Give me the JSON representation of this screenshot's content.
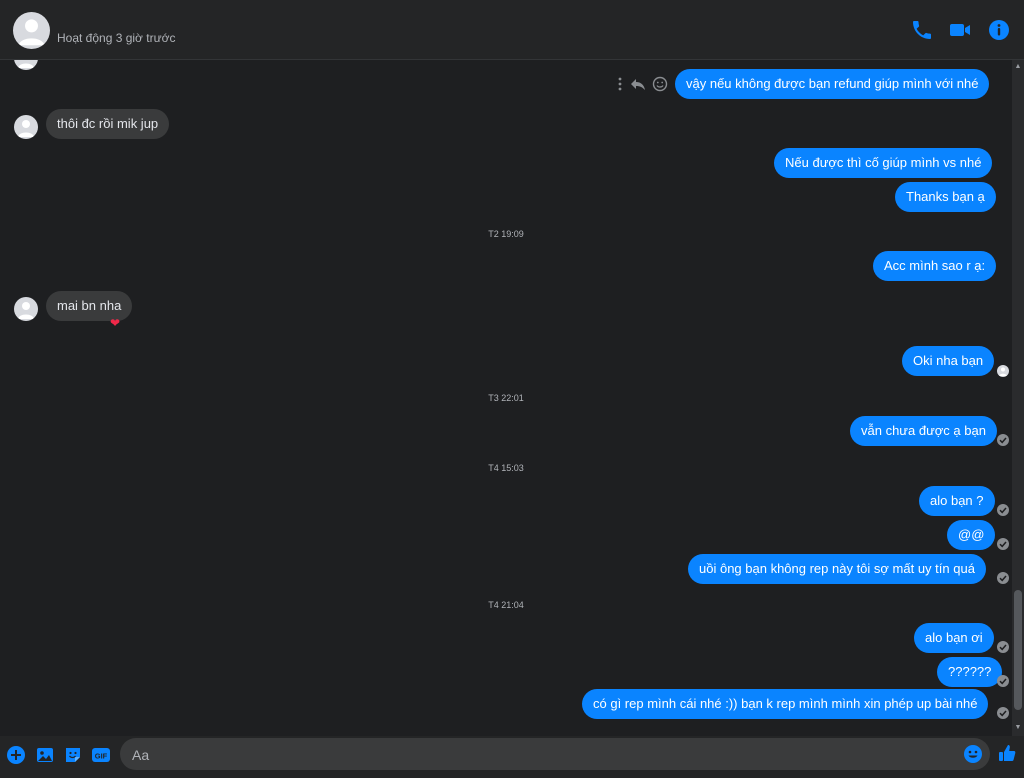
{
  "header": {
    "status": "Hoạt động 3 giờ trước",
    "icons": [
      "phone-icon",
      "video-icon",
      "info-icon"
    ]
  },
  "colors": {
    "accent": "#0a84ff",
    "background": "#1e1f21",
    "incoming_bubble": "#3a3b3c"
  },
  "messages": [
    {
      "from": "me",
      "text": "vậy nếu không được bạn refund giúp mình với nhé"
    },
    {
      "from": "them",
      "text": "thôi đc rồi mik jup"
    },
    {
      "from": "me",
      "text": "Nếu được thì cố giúp mình vs nhé"
    },
    {
      "from": "me",
      "text": "Thanks bạn ạ"
    },
    {
      "time": "T2 19:09"
    },
    {
      "from": "me",
      "text": "Acc mình sao r ạ:"
    },
    {
      "from": "them",
      "text": "mai bn nha",
      "reaction": "❤"
    },
    {
      "from": "me",
      "text": "Oki nha bạn"
    },
    {
      "time": "T3 22:01"
    },
    {
      "from": "me",
      "text": "vẫn chưa được ạ bạn"
    },
    {
      "time": "T4 15:03"
    },
    {
      "from": "me",
      "text": "alo bạn ?"
    },
    {
      "from": "me",
      "text": "@@"
    },
    {
      "from": "me",
      "text": "uồi ông bạn không rep này tôi sợ mất uy tín quá"
    },
    {
      "time": "T4 21:04"
    },
    {
      "from": "me",
      "text": "alo bạn ơi"
    },
    {
      "from": "me",
      "text": "??????"
    },
    {
      "from": "me",
      "text": "có gì rep mình cái nhé :)) bạn k rep mình mình xin phép up bài nhé"
    }
  ],
  "composer": {
    "placeholder": "Aa",
    "icons": [
      "plus-icon",
      "image-icon",
      "sticker-icon",
      "gif-icon",
      "emoji-icon",
      "like-icon"
    ],
    "gif_label": "GIF"
  }
}
